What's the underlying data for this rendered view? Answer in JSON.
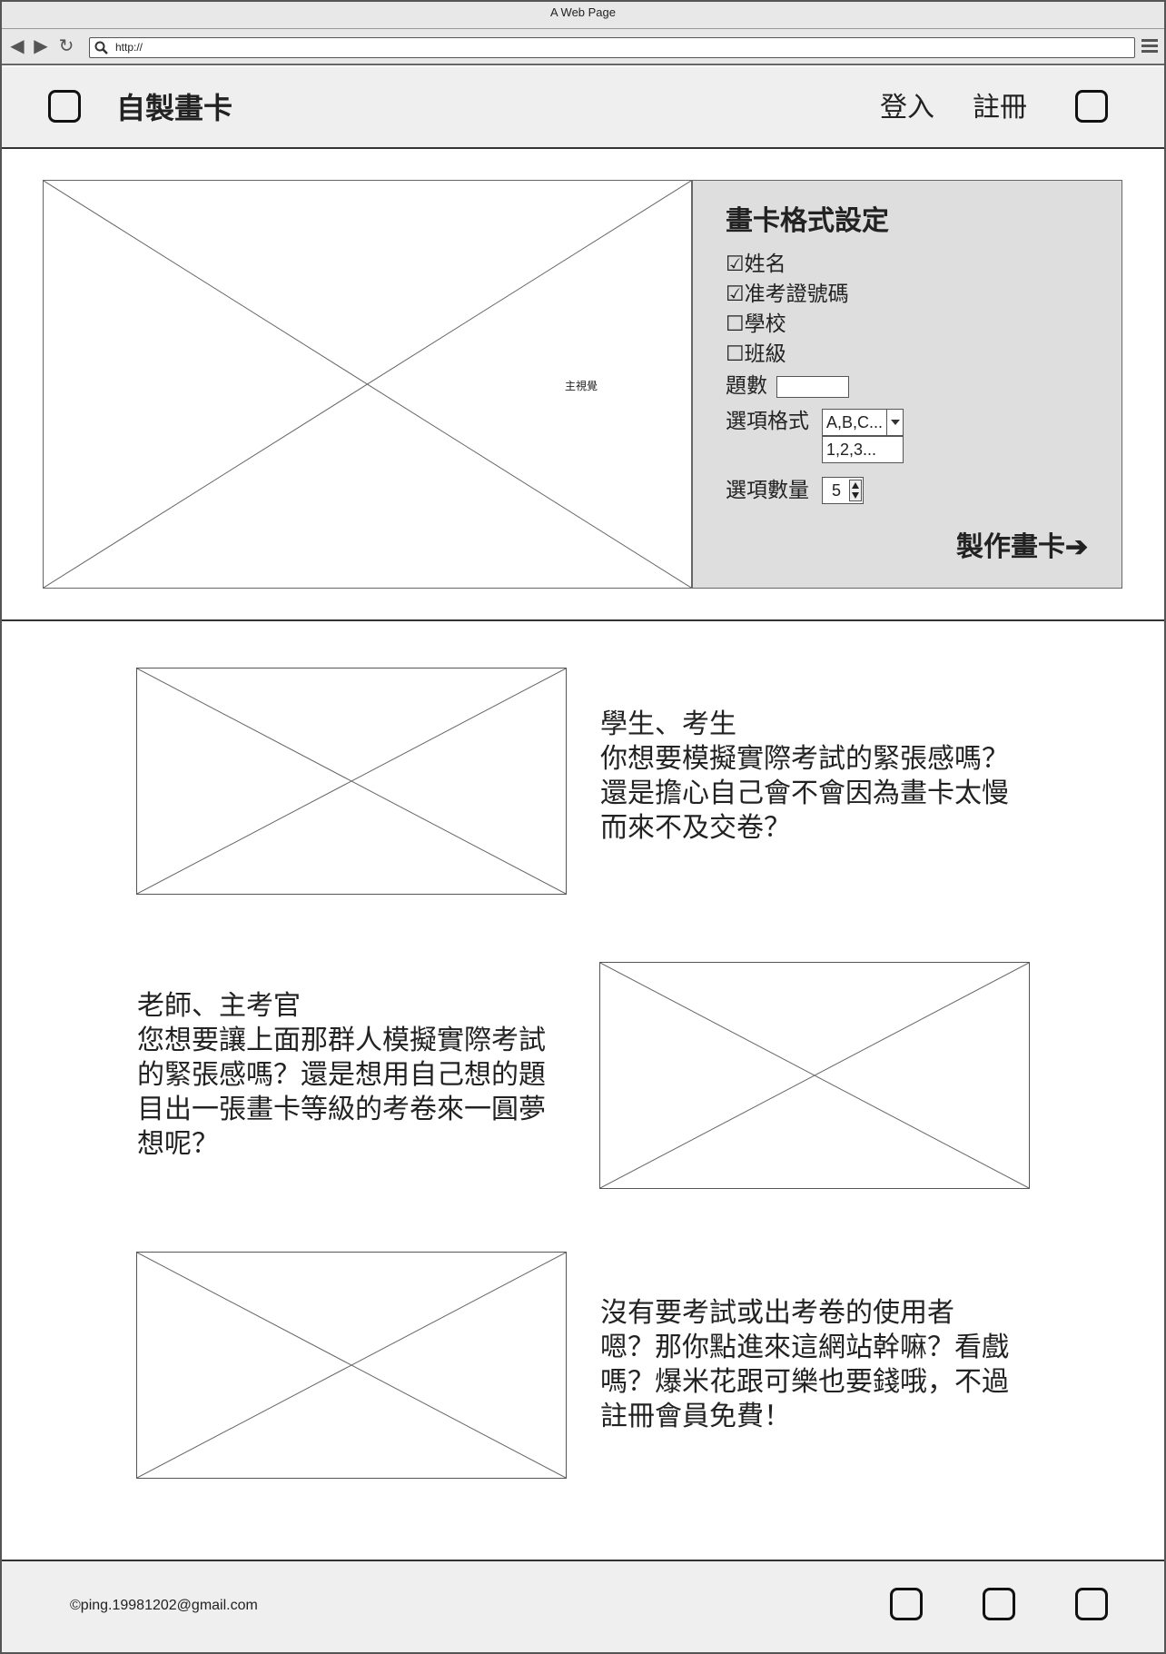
{
  "browser": {
    "title": "A Web Page",
    "url": "http://"
  },
  "header": {
    "title": "自製畫卡",
    "login": "登入",
    "register": "註冊"
  },
  "hero": {
    "image_label": "主視覺"
  },
  "panel": {
    "title": "畫卡格式設定",
    "checkboxes": [
      {
        "label": "姓名",
        "checked": true,
        "glyph": "☑"
      },
      {
        "label": "准考證號碼",
        "checked": true,
        "glyph": "☑"
      },
      {
        "label": "學校",
        "checked": false,
        "glyph": "☐"
      },
      {
        "label": "班級",
        "checked": false,
        "glyph": "☐"
      }
    ],
    "questions_label": "題數",
    "questions_value": "",
    "format_label": "選項格式",
    "format_selected": "A,B,C...",
    "format_option": "1,2,3...",
    "count_label": "選項數量",
    "count_value": "5",
    "make_button": "製作畫卡➔"
  },
  "features": [
    {
      "text": "學生、考生\n你想要模擬實際考試的緊張感嗎？還是擔心自己會不會因為畫卡太慢而來不及交卷？"
    },
    {
      "text": "老師、主考官\n您想要讓上面那群人模擬實際考試的緊張感嗎？還是想用自己想的題目出一張畫卡等級的考卷來一圓夢想呢？"
    },
    {
      "text": "沒有要考試或出考卷的使用者\n嗯？那你點進來這網站幹嘛？看戲嗎？爆米花跟可樂也要錢哦，不過註冊會員免費！"
    }
  ],
  "footer": {
    "email": "©ping.19981202@gmail.com"
  }
}
